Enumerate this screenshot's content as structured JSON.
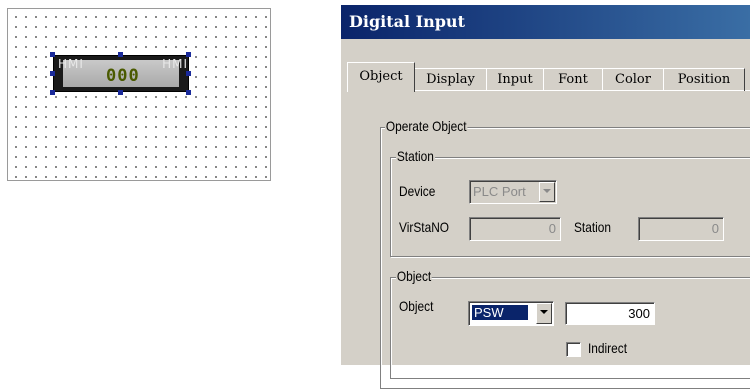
{
  "canvas": {
    "widget": {
      "watermark_left": "HMI",
      "watermark_right": "HMI",
      "display": "000"
    }
  },
  "dialog": {
    "title": "Digital Input",
    "tabs": [
      "Object",
      "Display",
      "Input",
      "Font",
      "Color",
      "Position"
    ],
    "active_tab": "Object",
    "operate_object": {
      "title": "Operate Object",
      "station": {
        "title": "Station",
        "device_label": "Device",
        "device_value": "PLC Port",
        "virstano_label": "VirStaNO",
        "virstano_value": "0",
        "station_label": "Station",
        "station_value": "0"
      },
      "object": {
        "title": "Object",
        "object_label": "Object",
        "object_type": "PSW",
        "address_value": "300",
        "indirect_label": "Indirect",
        "indirect_checked": false
      }
    }
  },
  "colors": {
    "title_bar_start": "#0a246a",
    "title_bar_end": "#3a6ea5",
    "dialog_bg": "#d4d0c8",
    "selection": "#0a246a",
    "digits": "#4a5a00"
  }
}
